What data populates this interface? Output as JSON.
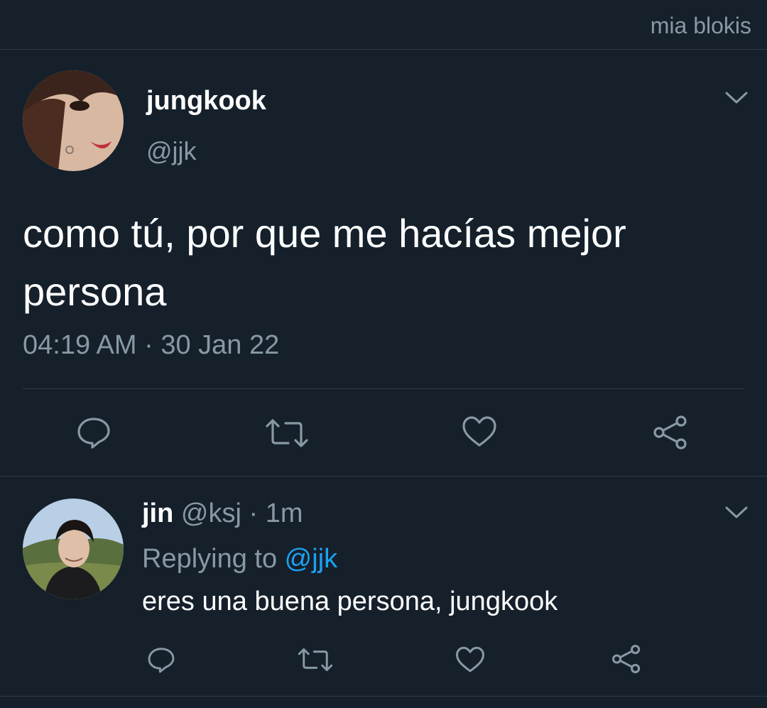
{
  "header": {
    "watermark": "mia blokis"
  },
  "tweet": {
    "avatar_icon": "profile-photo",
    "name": "jungkook",
    "handle": "@jjk",
    "text": "como tú, por que me hacías mejor persona",
    "time": "04:19 AM",
    "separator": " · ",
    "date": "30 Jan 22",
    "actions": [
      "reply-icon",
      "retweet-icon",
      "like-icon",
      "share-icon"
    ]
  },
  "reply": {
    "avatar_icon": "profile-photo",
    "name": "jin",
    "handle": "@ksj",
    "separator": " · ",
    "age": "1m",
    "replying_prefix": "Replying to ",
    "replying_to": "@jjk",
    "text": "eres una buena persona, jungkook",
    "actions": [
      "reply-icon",
      "retweet-icon",
      "like-icon",
      "share-icon"
    ]
  },
  "colors": {
    "background": "#15202b",
    "text": "#ffffff",
    "secondary_text": "#8899a6",
    "divider": "#2f3b47",
    "link": "#1da1f2"
  }
}
